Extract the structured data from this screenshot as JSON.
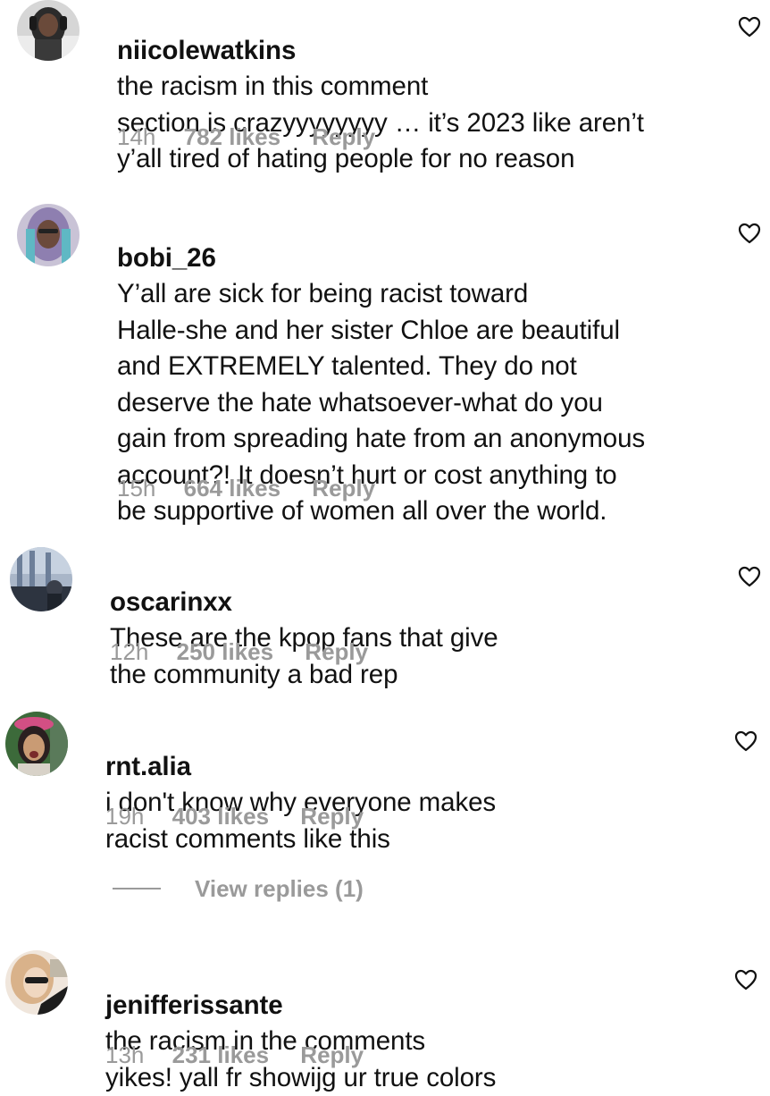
{
  "comments": [
    {
      "username": "niicolewatkins",
      "text": "the racism in this comment\nsection is crazyyyyyyyy … it’s 2023 like aren’t\ny’all tired of hating people for no reason",
      "time": "14h",
      "likes": "782 likes",
      "reply": "Reply",
      "avatar_colors": [
        "#2b2b2b",
        "#d8d8d8",
        "#6a4a3a"
      ]
    },
    {
      "username": "bobi_26",
      "text": "Y’all are sick for being racist toward\nHalle-she and her sister Chloe are beautiful\nand EXTREMELY talented. They do not\ndeserve the hate whatsoever-what do you\ngain from spreading hate from an anonymous\naccount?! It doesn’t hurt or cost anything to\nbe supportive of women all over the world.",
      "time": "15h",
      "likes": "664 likes",
      "reply": "Reply",
      "avatar_colors": [
        "#8e7fb0",
        "#5fb8c4",
        "#6b4a3c"
      ]
    },
    {
      "username": "oscarinxx",
      "text": "These are the kpop fans that give\nthe community a bad rep",
      "time": "12h",
      "likes": "250 likes",
      "reply": "Reply",
      "avatar_colors": [
        "#6d7f99",
        "#2d3440",
        "#a9b6c8"
      ]
    },
    {
      "username": "rnt.alia",
      "text": "i don't know why everyone makes\nracist comments like this",
      "time": "19h",
      "likes": "403 likes",
      "reply": "Reply",
      "avatar_colors": [
        "#3c6a3a",
        "#d24f84",
        "#c99b74"
      ]
    },
    {
      "username": "jenifferissante",
      "text": "the racism in the comments\nyikes! yall fr showijg ur true colors",
      "time": "13h",
      "likes": "231 likes",
      "reply": "Reply",
      "avatar_colors": [
        "#d9b28a",
        "#1d1d1d",
        "#f0d7c0"
      ]
    }
  ],
  "view_replies": "View replies (1)",
  "colors": {
    "text": "#111111",
    "meta": "#9a9a9a",
    "background": "#ffffff"
  }
}
